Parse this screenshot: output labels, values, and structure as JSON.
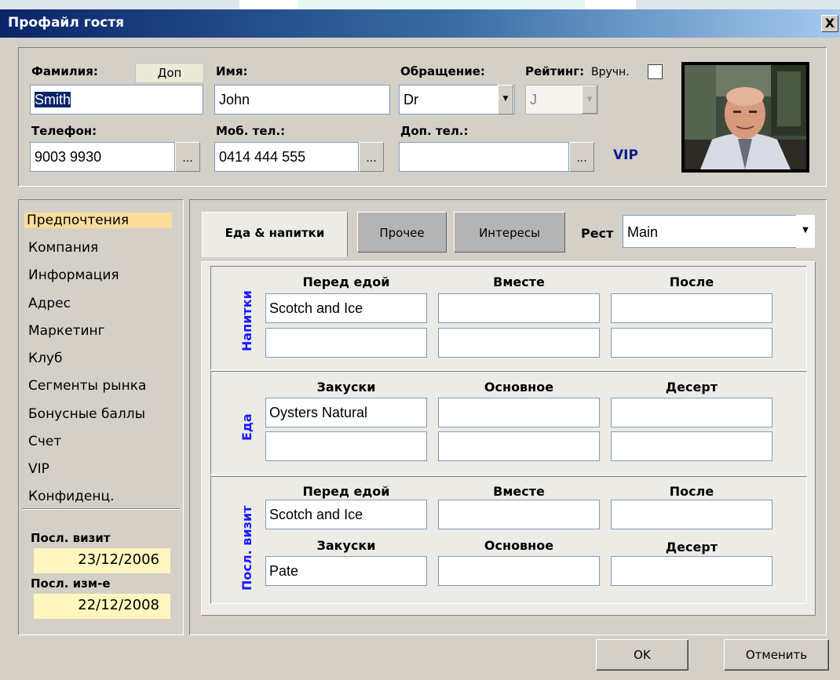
{
  "window": {
    "title": "Профайл гостя",
    "close_glyph": "X"
  },
  "guest": {
    "surname_label": "Фамилия:",
    "more_button": "Доп",
    "surname": "Smith",
    "name_label": "Имя:",
    "name": "John",
    "salutation_label": "Обращение:",
    "salutation": "Dr",
    "rating_label": "Рейтинг:",
    "manual_label": "Вручн.",
    "rating": "J",
    "phone_label": "Телефон:",
    "phone": "9003 9930",
    "mobile_label": "Моб. тел.:",
    "mobile": "0414 444 555",
    "extra_phone_label": "Доп. тел.:",
    "extra_phone": "",
    "ellipsis": "...",
    "vip_badge": "VIP"
  },
  "sidebar": {
    "items": [
      {
        "label": "Предпочтения"
      },
      {
        "label": "Компания"
      },
      {
        "label": "Информация"
      },
      {
        "label": "Адрес"
      },
      {
        "label": "Маркетинг"
      },
      {
        "label": "Клуб"
      },
      {
        "label": "Сегменты рынка"
      },
      {
        "label": "Бонусные баллы"
      },
      {
        "label": "Счет"
      },
      {
        "label": "VIP"
      },
      {
        "label": "Конфиденц."
      }
    ],
    "last_visit_label": "Посл. визит",
    "last_visit": "23/12/2006",
    "last_change_label": "Посл. изм-е",
    "last_change": "22/12/2008"
  },
  "tabs": [
    {
      "label": "Еда & напитки"
    },
    {
      "label": "Прочее"
    },
    {
      "label": "Интересы"
    }
  ],
  "restaurant": {
    "label": "Рест",
    "value": "Main"
  },
  "drinks": {
    "label": "Напитки",
    "headers": [
      "Перед едой",
      "Вместе",
      "После"
    ],
    "rows": [
      [
        "Scotch and Ice",
        "",
        ""
      ],
      [
        "",
        "",
        ""
      ]
    ]
  },
  "food": {
    "label": "Еда",
    "headers": [
      "Закуски",
      "Основное",
      "Десерт"
    ],
    "rows": [
      [
        "Oysters Natural",
        "",
        ""
      ],
      [
        "",
        "",
        ""
      ]
    ]
  },
  "last_visit_section": {
    "label": "Посл. визит",
    "drink_headers": [
      "Перед едой",
      "Вместе",
      "После"
    ],
    "drinks": [
      "Scotch and Ice",
      "",
      ""
    ],
    "food_headers": [
      "Закуски",
      "Основное",
      "Десерт"
    ],
    "food": [
      "Pate",
      "",
      ""
    ]
  },
  "buttons": {
    "ok": "OK",
    "cancel": "Отменить"
  }
}
